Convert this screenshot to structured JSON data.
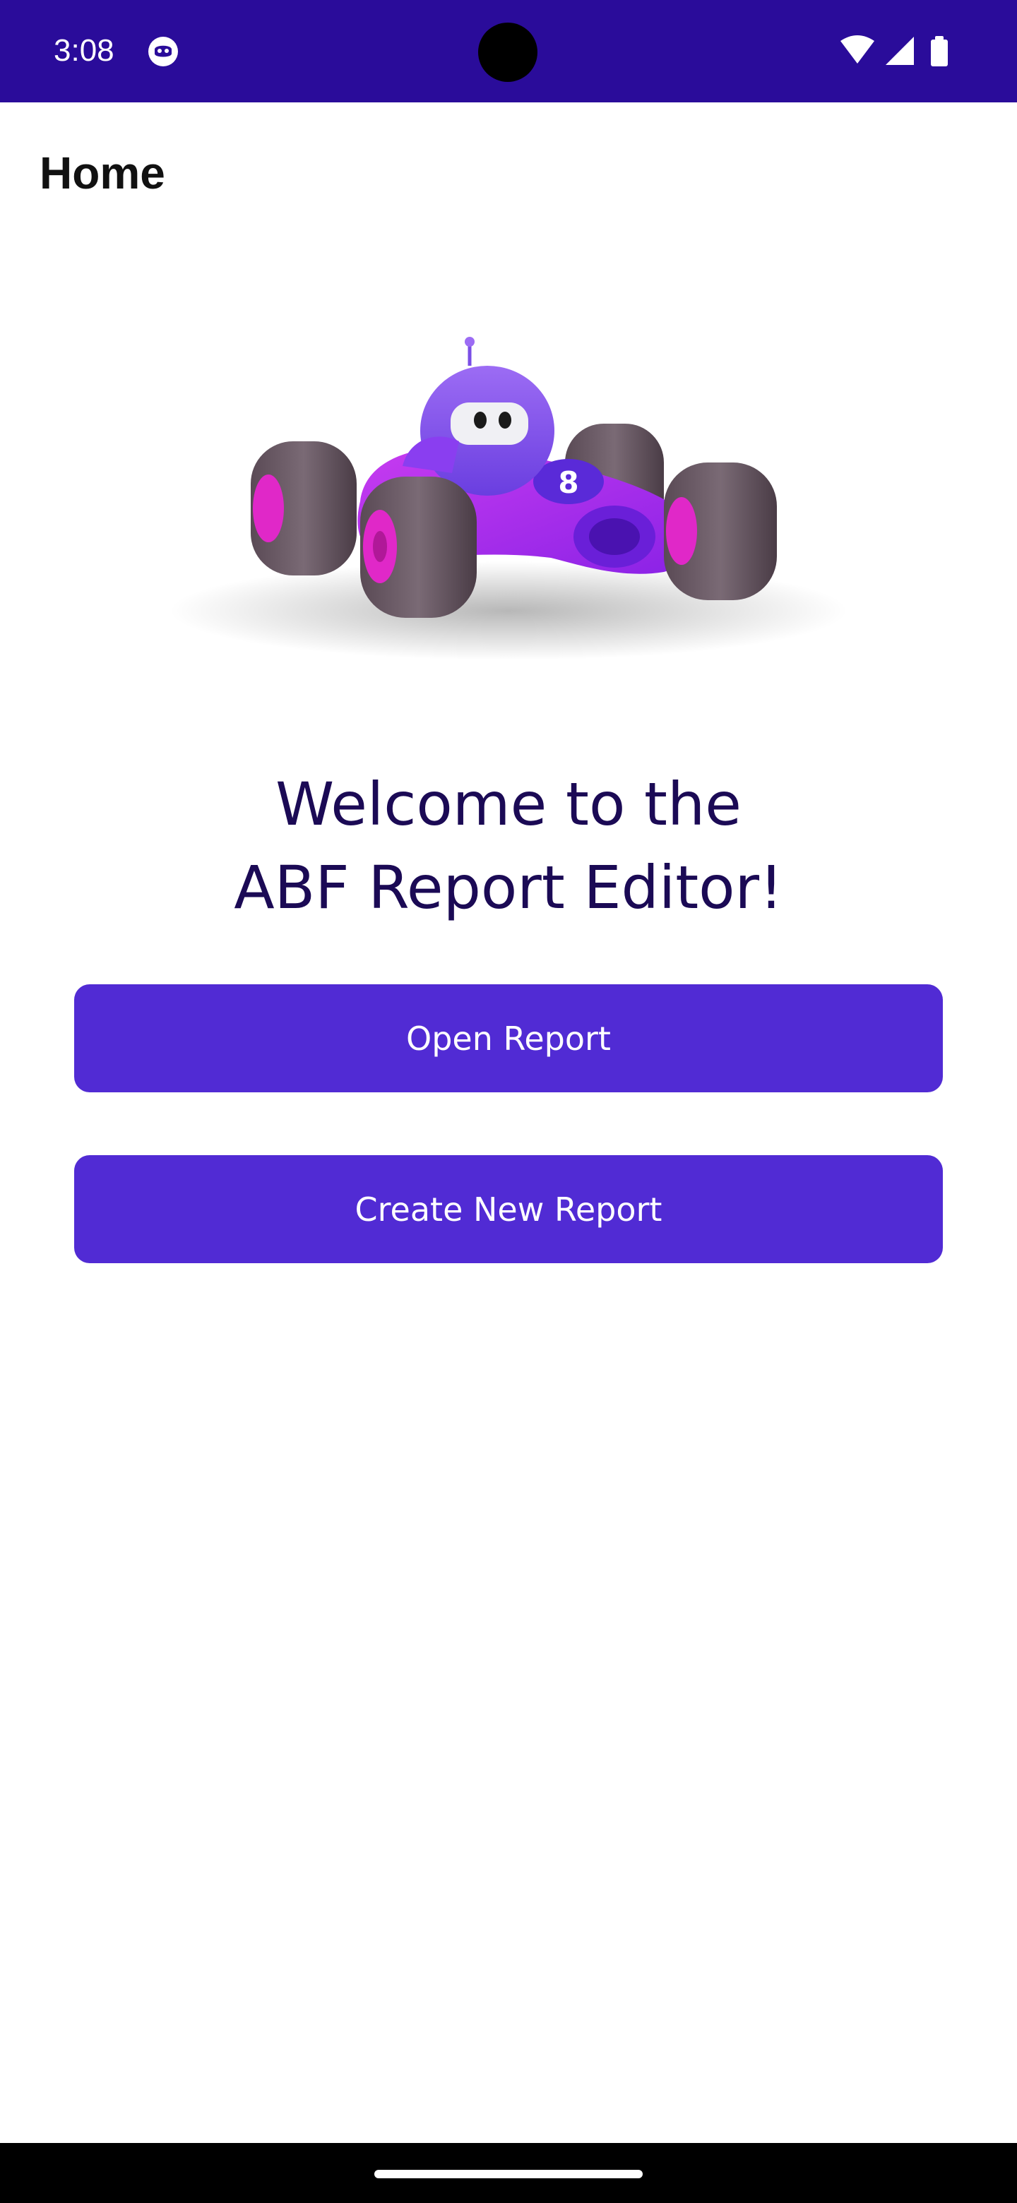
{
  "status_bar": {
    "time": "3:08",
    "background": "#2a0c9a",
    "icons": [
      "app-notification-icon",
      "wifi-icon",
      "cellular-signal-icon",
      "battery-icon"
    ]
  },
  "header": {
    "title": "Home"
  },
  "hero": {
    "image": "race-car-robot-illustration"
  },
  "welcome": {
    "line1": "Welcome to the",
    "line2": "ABF Report Editor!",
    "color": "#1b0a55"
  },
  "actions": {
    "open_label": "Open Report",
    "create_label": "Create New Report",
    "button_color": "#512bd4"
  },
  "nav_bar": {
    "background": "#000000"
  }
}
